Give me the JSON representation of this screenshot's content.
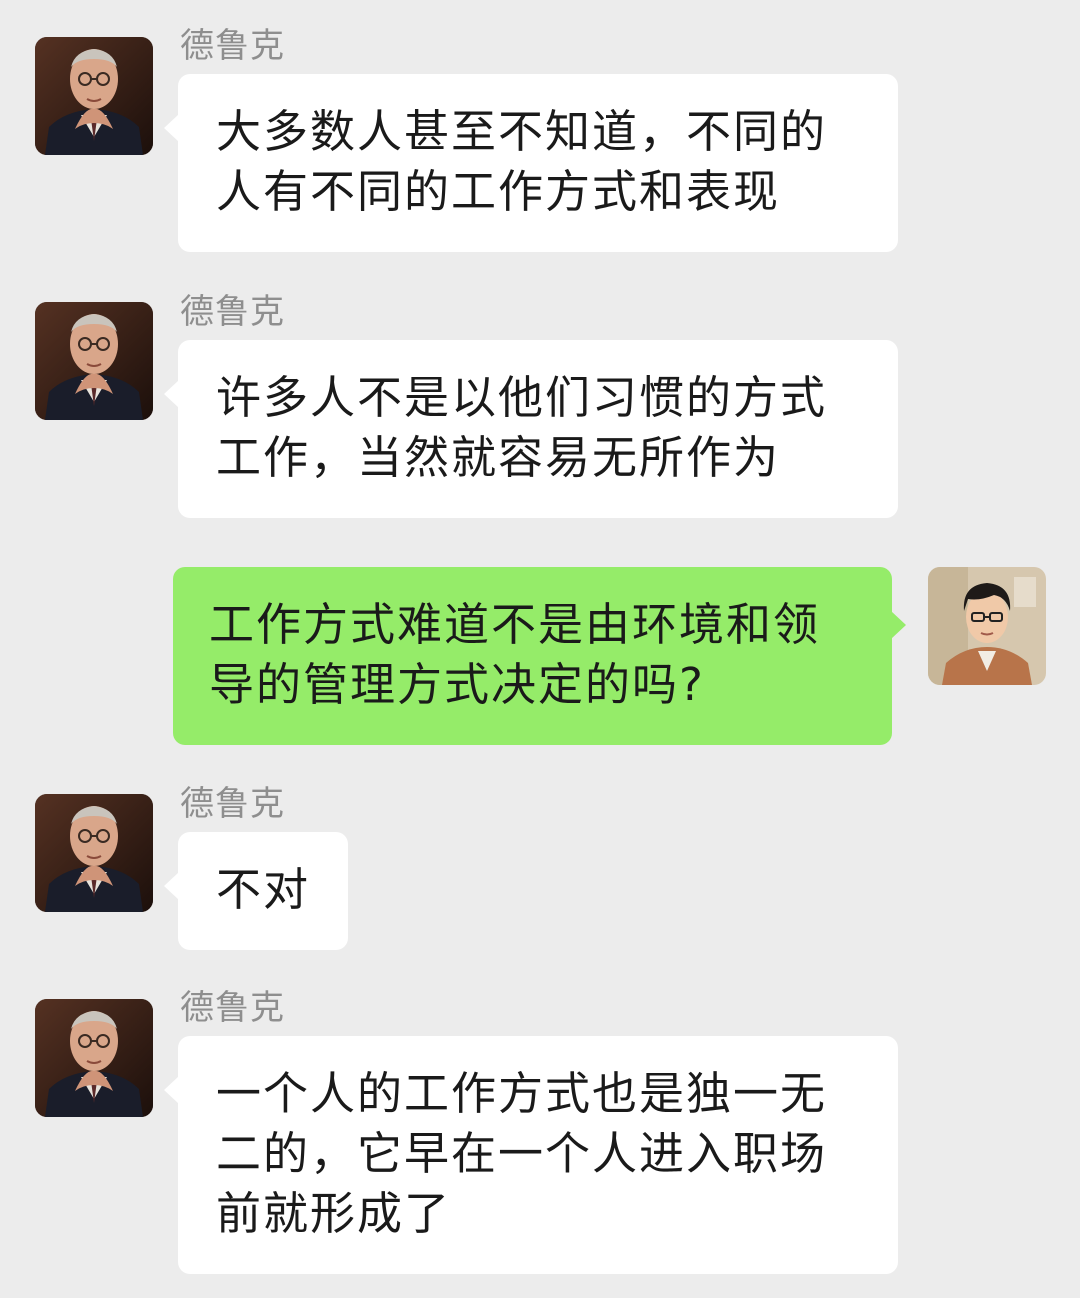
{
  "chat": {
    "messages": [
      {
        "sender": "德鲁克",
        "direction": "incoming",
        "avatar_icon": "elderly-man-avatar",
        "lines": [
          "大多数人甚至不知道，不同的",
          "人有不同的工作方式和表现"
        ]
      },
      {
        "sender": "德鲁克",
        "direction": "incoming",
        "avatar_icon": "elderly-man-avatar",
        "lines": [
          "许多人不是以他们习惯的方式",
          "工作，当然就容易无所作为"
        ]
      },
      {
        "sender": "",
        "direction": "outgoing",
        "avatar_icon": "young-man-avatar",
        "lines": [
          "工作方式难道不是由环境和领",
          "导的管理方式决定的吗?"
        ]
      },
      {
        "sender": "德鲁克",
        "direction": "incoming",
        "avatar_icon": "elderly-man-avatar",
        "lines": [
          "不对"
        ]
      },
      {
        "sender": "德鲁克",
        "direction": "incoming",
        "avatar_icon": "elderly-man-avatar",
        "lines": [
          "一个人的工作方式也是独一无",
          "二的，它早在一个人进入职场",
          "前就形成了"
        ]
      }
    ]
  },
  "colors": {
    "background": "#ececec",
    "incoming_bubble": "#ffffff",
    "outgoing_bubble": "#95ec69",
    "sender_name": "#8e8e8e",
    "text": "#1a1a1a"
  }
}
